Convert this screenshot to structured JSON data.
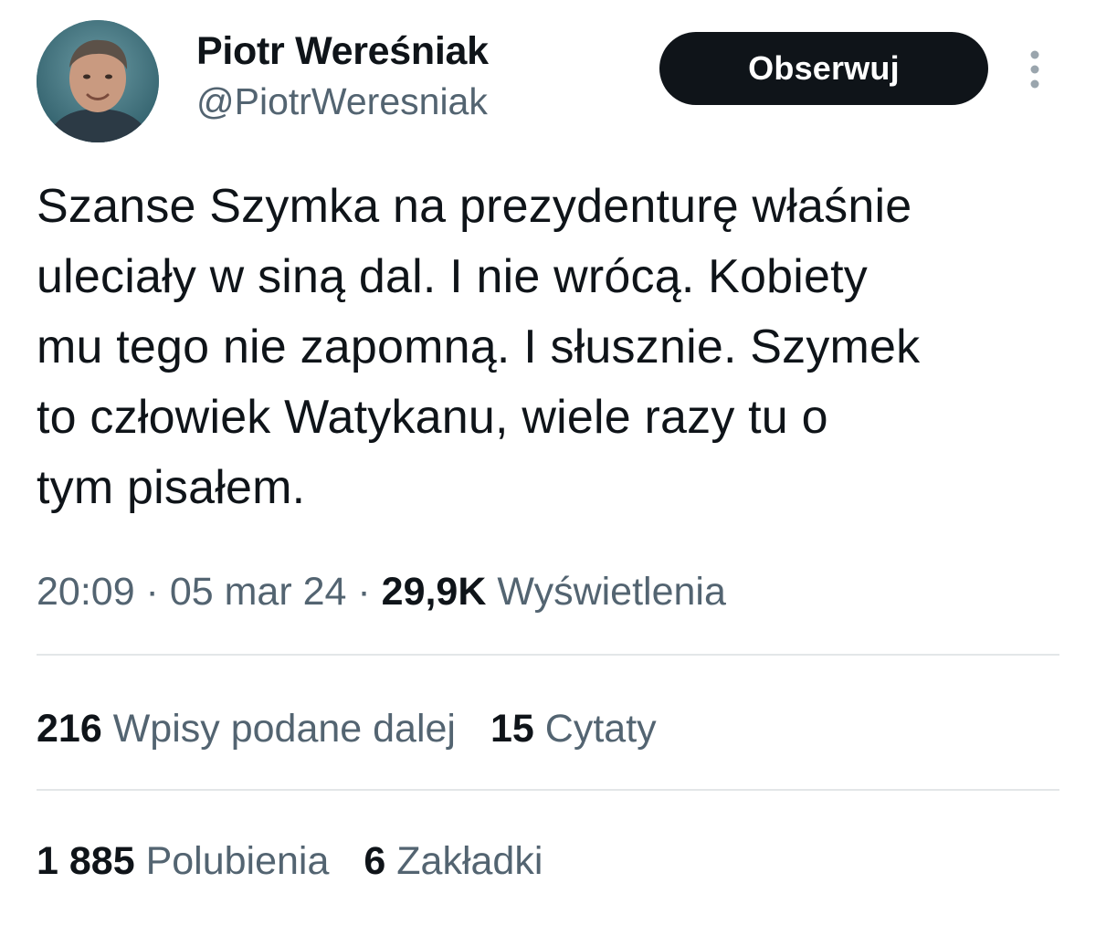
{
  "author": {
    "name": "Piotr Wereśniak",
    "handle": "@PiotrWeresniak"
  },
  "follow_button_label": "Obserwuj",
  "more_icon": "more-vertical-icon",
  "tweet": {
    "lines": [
      "Szanse Szymka na prezydenturę właśnie",
      "uleciały w siną dal. I nie wrócą. Kobiety",
      "mu tego nie zapomną. I słusznie. Szymek",
      "to człowiek Watykanu, wiele razy tu o",
      "tym pisałem."
    ]
  },
  "meta": {
    "time": "20:09",
    "separator": " · ",
    "date": "05 mar 24",
    "views_count": "29,9K",
    "views_label": "Wyświetlenia"
  },
  "stats": {
    "retweets_count": "216",
    "retweets_label": "Wpisy podane dalej",
    "quotes_count": "15",
    "quotes_label": "Cytaty",
    "likes_count": "1 885",
    "likes_label": "Polubienia",
    "bookmarks_count": "6",
    "bookmarks_label": "Zakładki"
  },
  "colors": {
    "text": "#0f1419",
    "secondary": "#536471",
    "button_bg": "#0f1419",
    "divider": "#e3e6e8"
  }
}
